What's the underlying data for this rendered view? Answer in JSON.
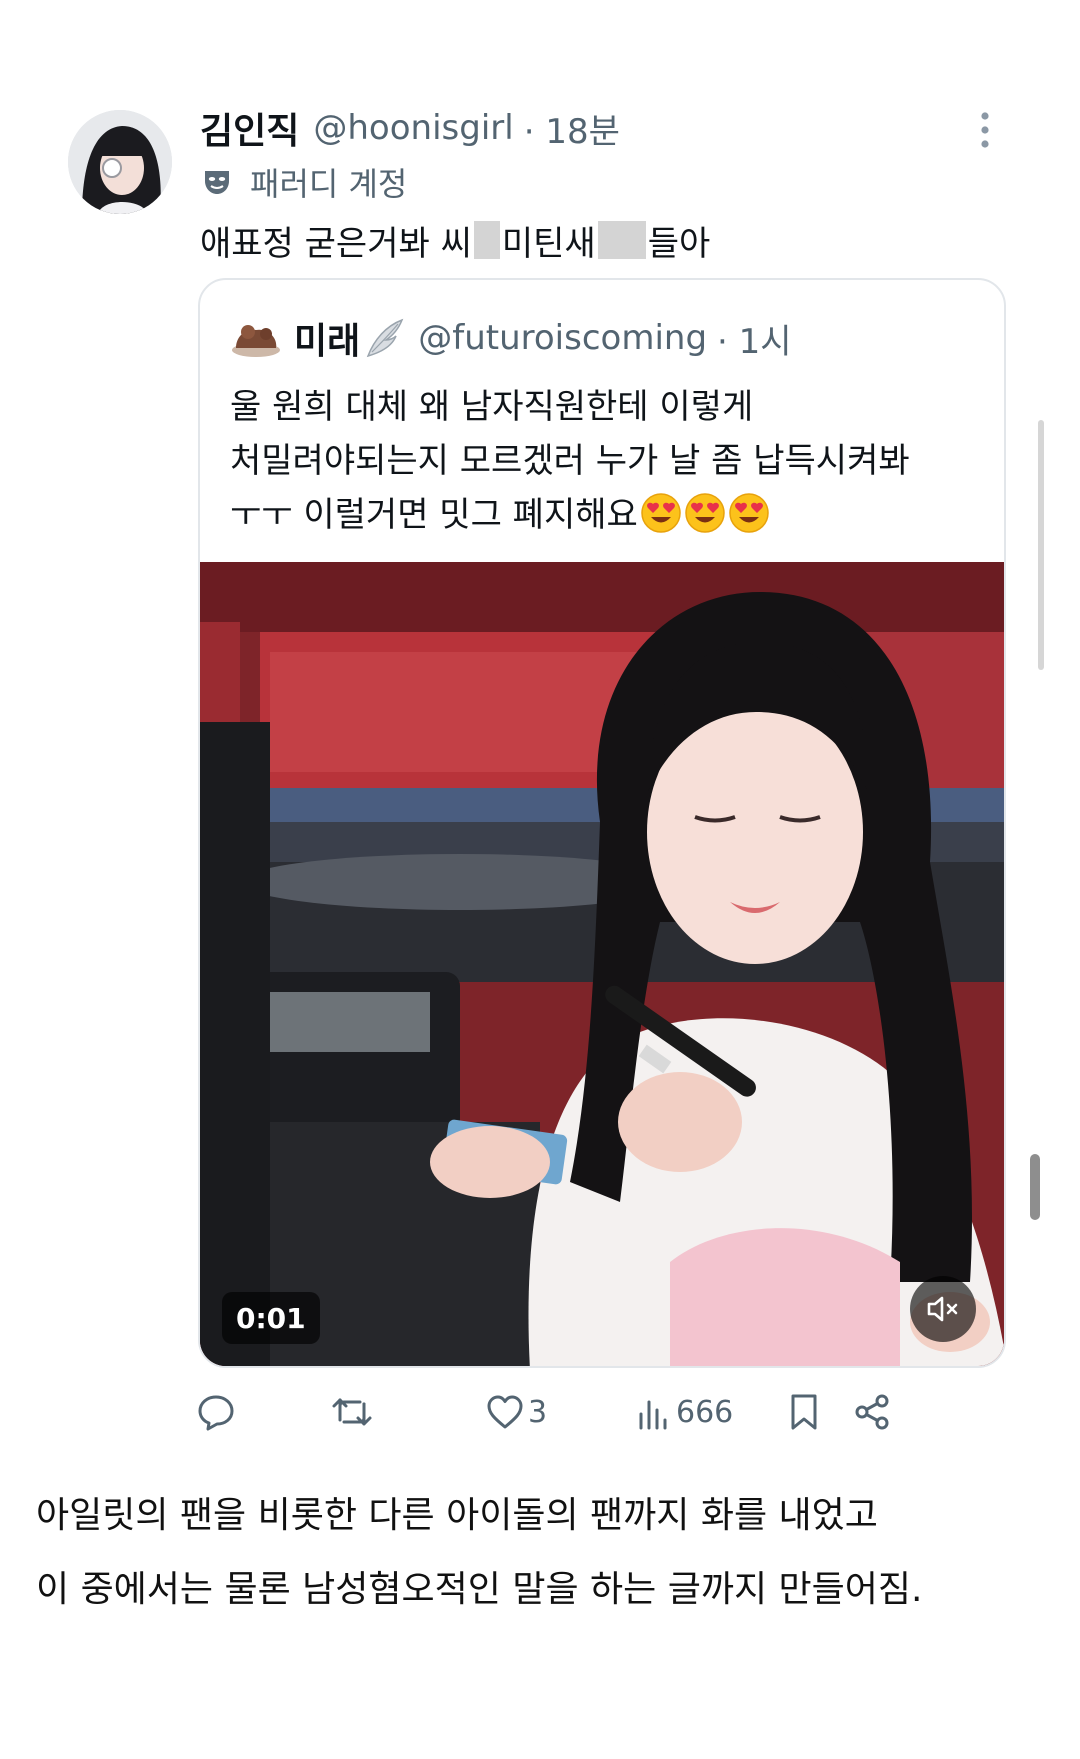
{
  "tweet": {
    "display_name": "김인직",
    "handle": "@hoonisgirl",
    "time": "· 18분",
    "parody_label": "패러디 계정",
    "text_part1": "애표정 굳은거봐 씨",
    "text_part2": "미틴새",
    "text_part3": "들아"
  },
  "quote": {
    "display_name": "미래",
    "handle": "@futuroiscoming",
    "time": "· 1시",
    "lines": [
      "울 원희 대체 왜 남자직원한테 이렇게",
      "처밀려야되는지 모르겠러 누가 날 좀 납득시켜봐",
      "ㅜㅜ 이럴거면 밋그 폐지해요"
    ],
    "video_duration": "0:01"
  },
  "actions": {
    "likes": "3",
    "views": "666"
  },
  "caption": {
    "line1": "아일릿의 팬을 비롯한 다른 아이돌의 팬까지 화를 내었고",
    "line2": "이 중에서는 물론 남성혐오적인 말을 하는 글까지 만들어짐."
  },
  "icons": [
    "more-icon",
    "parody-mask-icon",
    "reply-icon",
    "retweet-icon",
    "like-icon",
    "views-icon",
    "bookmark-icon",
    "share-icon",
    "mute-icon"
  ],
  "colors": {
    "text": "#0f1419",
    "secondary": "#536471",
    "border": "#e2e6ea"
  }
}
